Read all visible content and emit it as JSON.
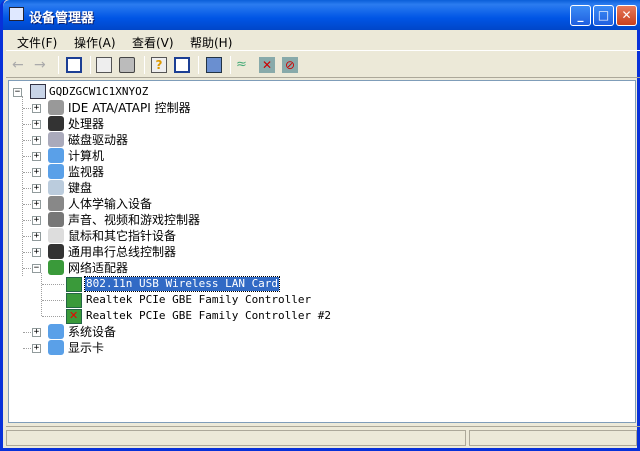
{
  "window": {
    "title": "设备管理器",
    "min": "_",
    "max": "□",
    "close": "✕"
  },
  "menu": [
    "文件(F)",
    "操作(A)",
    "查看(V)",
    "帮助(H)"
  ],
  "toolbar": [
    "back-icon",
    "forward-icon",
    "show-hide-console-tree-icon",
    "properties-icon",
    "print-icon",
    "help-icon",
    "show-hide-action-pane-icon",
    "scan-hardware-icon",
    "update-driver-icon",
    "uninstall-icon",
    "disable-icon"
  ],
  "tree": {
    "root": "GQDZGCW1C1XNYOZ",
    "categories": [
      {
        "label": "IDE ATA/ATAPI 控制器",
        "icon": "ide-controller-icon",
        "expanded": false
      },
      {
        "label": "处理器",
        "icon": "processor-icon",
        "expanded": false
      },
      {
        "label": "磁盘驱动器",
        "icon": "disk-drive-icon",
        "expanded": false
      },
      {
        "label": "计算机",
        "icon": "computer-icon",
        "expanded": false
      },
      {
        "label": "监视器",
        "icon": "monitor-icon",
        "expanded": false
      },
      {
        "label": "键盘",
        "icon": "keyboard-icon",
        "expanded": false
      },
      {
        "label": "人体学输入设备",
        "icon": "hid-icon",
        "expanded": false
      },
      {
        "label": "声音、视频和游戏控制器",
        "icon": "sound-icon",
        "expanded": false
      },
      {
        "label": "鼠标和其它指针设备",
        "icon": "mouse-icon",
        "expanded": false
      },
      {
        "label": "通用串行总线控制器",
        "icon": "usb-icon",
        "expanded": false
      },
      {
        "label": "网络适配器",
        "icon": "network-adapter-icon",
        "expanded": true,
        "children": [
          {
            "label": "802.11n USB Wireless LAN Card",
            "selected": true,
            "disabled": false
          },
          {
            "label": "Realtek PCIe GBE Family Controller",
            "selected": false,
            "disabled": false
          },
          {
            "label": "Realtek PCIe GBE Family Controller #2",
            "selected": false,
            "disabled": true
          }
        ]
      },
      {
        "label": "系统设备",
        "icon": "system-device-icon",
        "expanded": false
      },
      {
        "label": "显示卡",
        "icon": "display-adapter-icon",
        "expanded": false
      }
    ]
  }
}
